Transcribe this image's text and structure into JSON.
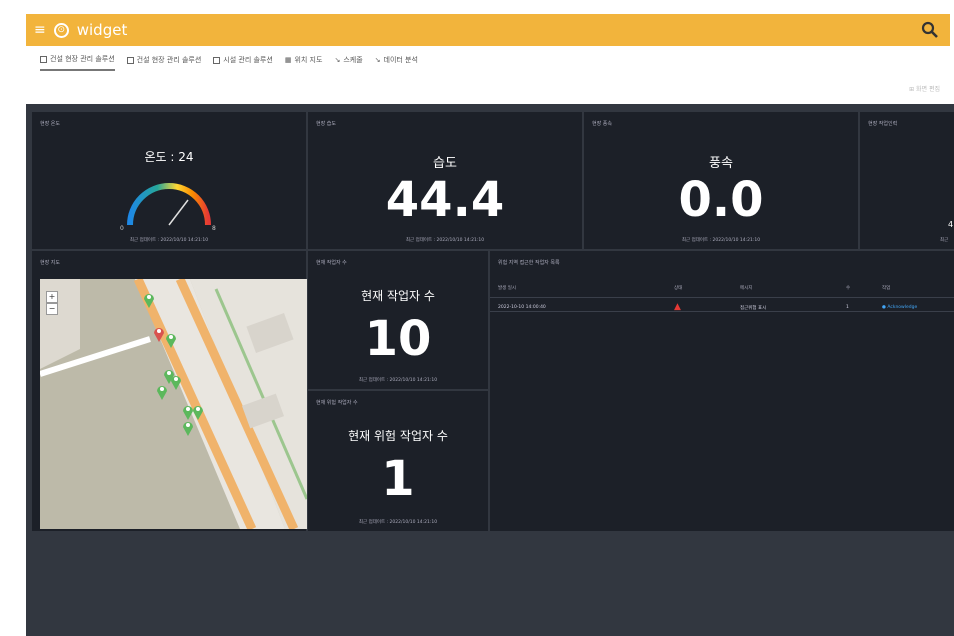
{
  "app": {
    "title": "widget"
  },
  "tabs": [
    {
      "label": "건설 현장 관리 솔루션"
    },
    {
      "label": "건설 현장 관리 솔루션"
    },
    {
      "label": "시설 관리 솔루션"
    },
    {
      "label": "위치 지도"
    },
    {
      "label": "스케줄"
    },
    {
      "label": "데이터 분석"
    }
  ],
  "toolbar": {
    "link": "화면 편집"
  },
  "panels": {
    "temperature": {
      "title": "현장 온도",
      "label": "온도 : 24",
      "value": 24,
      "scale_min": "0",
      "scale_max": "8",
      "ticks": [
        "0",
        "1",
        "2",
        "3",
        "4",
        "5",
        "6",
        "7",
        "8"
      ],
      "footer": "최근 업데이트 : 2022/10/10 14:21:10"
    },
    "humidity": {
      "title": "현장 습도",
      "label": "습도",
      "value": "44.4",
      "footer": "최근 업데이트 : 2022/10/10 14:21:10"
    },
    "wind": {
      "title": "현장 풍속",
      "label": "풍속",
      "value": "0.0",
      "footer": "최근 업데이트 : 2022/10/10 14:21:10"
    },
    "fourth": {
      "title": "현장 작업인력",
      "value": "4",
      "footer": "최근"
    },
    "map": {
      "title": "현장 지도"
    },
    "workers": {
      "title": "현재 작업자 수",
      "label": "현재 작업자 수",
      "value": "10",
      "footer": "최근 업데이트 : 2022/10/10 14:21:10"
    },
    "danger": {
      "title": "현재 위험 작업자 수",
      "label": "현재 위험 작업자 수",
      "value": "1",
      "footer": "최근 업데이트 : 2022/10/10 14:21:10"
    },
    "events": {
      "title": "위험 지역 접근한 작업자 목록",
      "columns": [
        "발생 일시",
        "상태",
        "메시지",
        "수",
        "작업"
      ],
      "rows": [
        {
          "time": "2022-10-10 14:00:40",
          "status": "warning",
          "message": "접근위험 표시",
          "count": "1",
          "action": "Acknowledge"
        }
      ]
    }
  },
  "colors": {
    "accent": "#f2b43c",
    "panel": "#1c2028",
    "dashboard": "#323740",
    "pin_green": "#5cb85c",
    "pin_red": "#d9534f"
  }
}
